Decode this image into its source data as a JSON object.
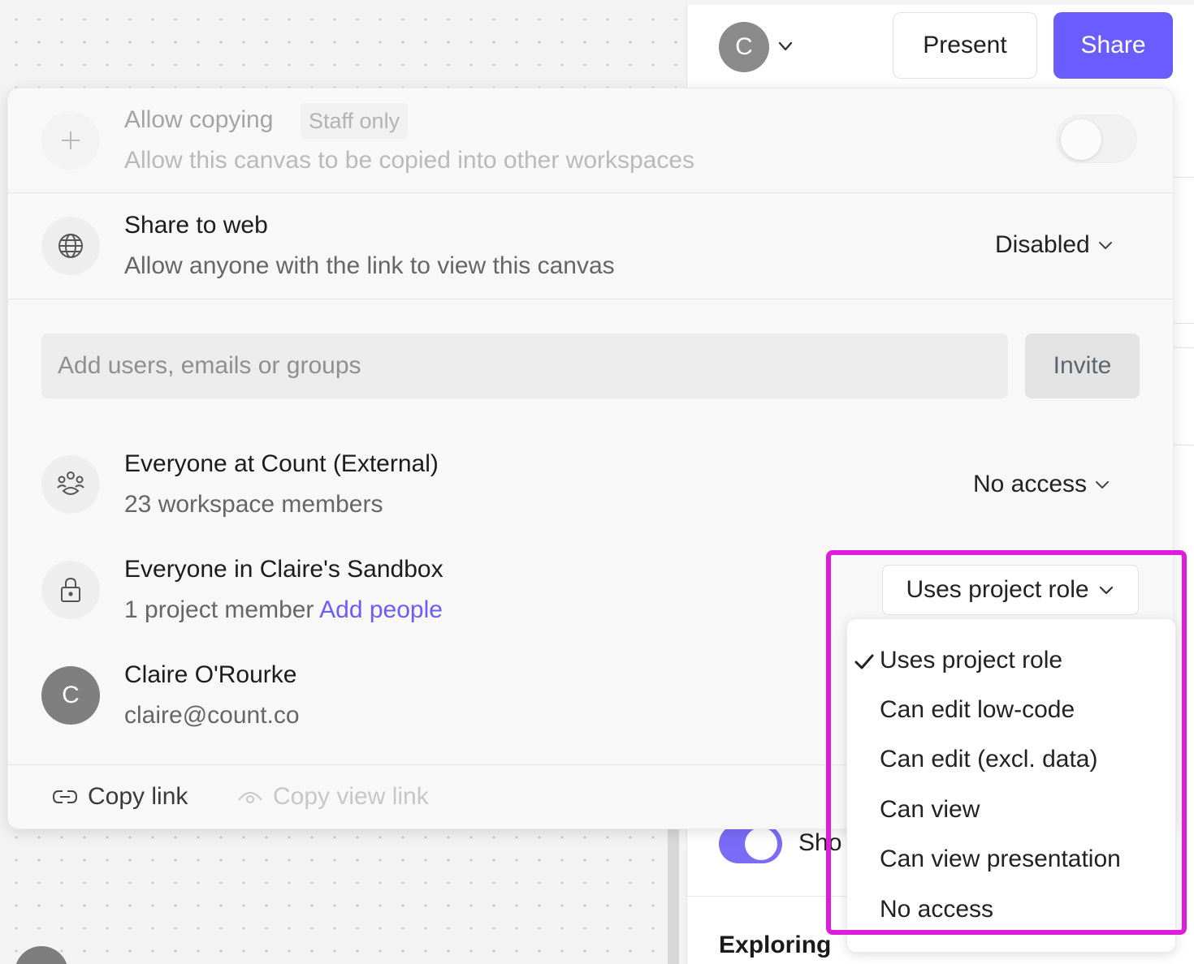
{
  "header": {
    "avatar_initial": "C",
    "present_label": "Present",
    "share_label": "Share"
  },
  "side_panel": {
    "show_label": "Sho",
    "exploring_label": "Exploring"
  },
  "share_dialog": {
    "allow_copying": {
      "title": "Allow copying",
      "badge": "Staff only",
      "subtitle": "Allow this canvas to be copied into other workspaces",
      "enabled": false
    },
    "share_to_web": {
      "title": "Share to web",
      "subtitle": "Allow anyone with the link to view this canvas",
      "value": "Disabled"
    },
    "invite": {
      "placeholder": "Add users, emails or groups",
      "button_label": "Invite"
    },
    "members": [
      {
        "name": "Everyone at Count (External)",
        "detail": "23 workspace members",
        "access": "No access"
      },
      {
        "name": "Everyone in Claire's Sandbox",
        "detail": "1 project member",
        "link": "Add people",
        "access": "Uses project role"
      },
      {
        "avatar_initial": "C",
        "name": "Claire O'Rourke",
        "detail": "claire@count.co"
      }
    ],
    "footer": {
      "copy_link": "Copy link",
      "copy_view_link": "Copy view link"
    }
  },
  "role_menu": {
    "selected": "Uses project role",
    "options": [
      "Uses project role",
      "Can edit low-code",
      "Can edit (excl. data)",
      "Can view",
      "Can view presentation",
      "No access"
    ]
  },
  "colors": {
    "accent": "#6a5cff",
    "highlight": "#e01cdc",
    "toggle_on": "#7b6cf7"
  }
}
